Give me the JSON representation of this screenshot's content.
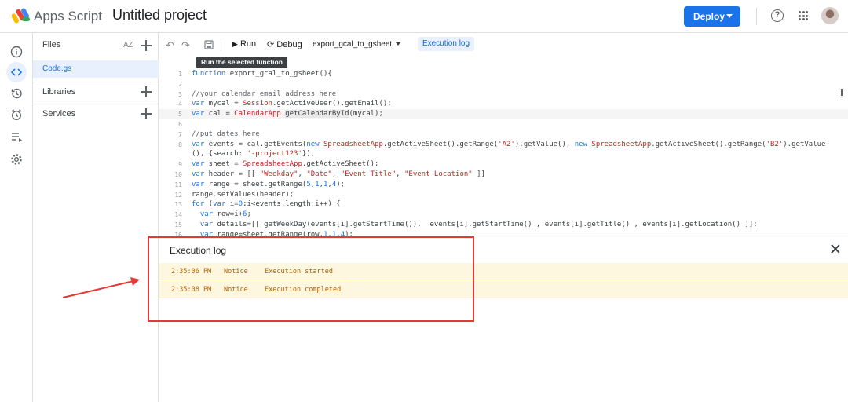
{
  "header": {
    "app_name": "Apps Script",
    "project_name": "Untitled project",
    "deploy_label": "Deploy",
    "help_label": "?"
  },
  "files_panel": {
    "files_label": "Files",
    "sort_label": "AZ",
    "files": [
      "Code.gs"
    ],
    "libraries_label": "Libraries",
    "services_label": "Services"
  },
  "toolbar": {
    "run_label": "Run",
    "debug_label": "Debug",
    "function_name": "export_gcal_to_gsheet",
    "execution_log_label": "Execution log",
    "tooltip": "Run the selected function"
  },
  "code_lines": [
    {
      "n": "1",
      "html": "<span class=\"kw\">function</span> export_gcal_to_gsheet(){"
    },
    {
      "n": "2",
      "html": ""
    },
    {
      "n": "3",
      "html": "<span class=\"cmt\">//your calendar email address here</span>"
    },
    {
      "n": "4",
      "html": "<span class=\"kw\">var</span> mycal = <span class=\"cls\">Session</span>.getActiveUser().getEmail();"
    },
    {
      "n": "5",
      "html": "<span class=\"kw\">var</span> cal = <span class=\"cls\">CalendarApp</span>.<span class=\"hl\">getCalendarById</span>(mycal);"
    },
    {
      "n": "6",
      "html": ""
    },
    {
      "n": "7",
      "html": "<span class=\"cmt\">//put dates here</span>"
    },
    {
      "n": "8",
      "html": "<span class=\"kw\">var</span> events = cal.getEvents(<span class=\"kw\">new</span> <span class=\"cls\">SpreadsheetApp</span>.getActiveSheet().getRange(<span class=\"str\">'A2'</span>).getValue(), <span class=\"kw\">new</span> <span class=\"cls\">SpreadsheetApp</span>.getActiveSheet().getRange(<span class=\"str\">'B2'</span>).getValue"
    },
    {
      "n": "",
      "html": "(), {search: <span class=\"str\">'-project123'</span>});"
    },
    {
      "n": "9",
      "html": "<span class=\"kw\">var</span> sheet = <span class=\"cls\">SpreadsheetApp</span>.getActiveSheet();"
    },
    {
      "n": "10",
      "html": "<span class=\"kw\">var</span> header = [[ <span class=\"str\">\"Weekday\"</span>, <span class=\"str\">\"Date\"</span>, <span class=\"str\">\"Event Title\"</span>, <span class=\"str\">\"Event Location\"</span> ]]"
    },
    {
      "n": "11",
      "html": "<span class=\"kw\">var</span> range = sheet.getRange(<span class=\"num\">5</span>,<span class=\"num\">1</span>,<span class=\"num\">1</span>,<span class=\"num\">4</span>);"
    },
    {
      "n": "12",
      "html": "range.setValues(header);"
    },
    {
      "n": "13",
      "html": "<span class=\"kw\">for</span> (<span class=\"kw\">var</span> i=<span class=\"num\">0</span>;i&lt;events.length;i++) {"
    },
    {
      "n": "14",
      "html": "  <span class=\"kw\">var</span> row=i+<span class=\"num\">6</span>;"
    },
    {
      "n": "15",
      "html": "  <span class=\"kw\">var</span> details=[[ getWeekDay(events[i].getStartTime()),  events[i].getStartTime() , events[i].getTitle() , events[i].getLocation() ]];"
    },
    {
      "n": "16",
      "html": "  <span class=\"kw\">var</span> range=sheet.getRange(row,<span class=\"num\">1</span>,<span class=\"num\">1</span>,<span class=\"num\">4</span>);"
    }
  ],
  "execution_log": {
    "title": "Execution log",
    "entries": [
      {
        "time": "2:35:06 PM",
        "level": "Notice",
        "message": "Execution started"
      },
      {
        "time": "2:35:08 PM",
        "level": "Notice",
        "message": "Execution completed"
      }
    ]
  },
  "colors": {
    "accent": "#1a73e8",
    "log_row_bg": "#fef7e0",
    "log_text": "#b06000",
    "annotation_red": "#e53935"
  }
}
